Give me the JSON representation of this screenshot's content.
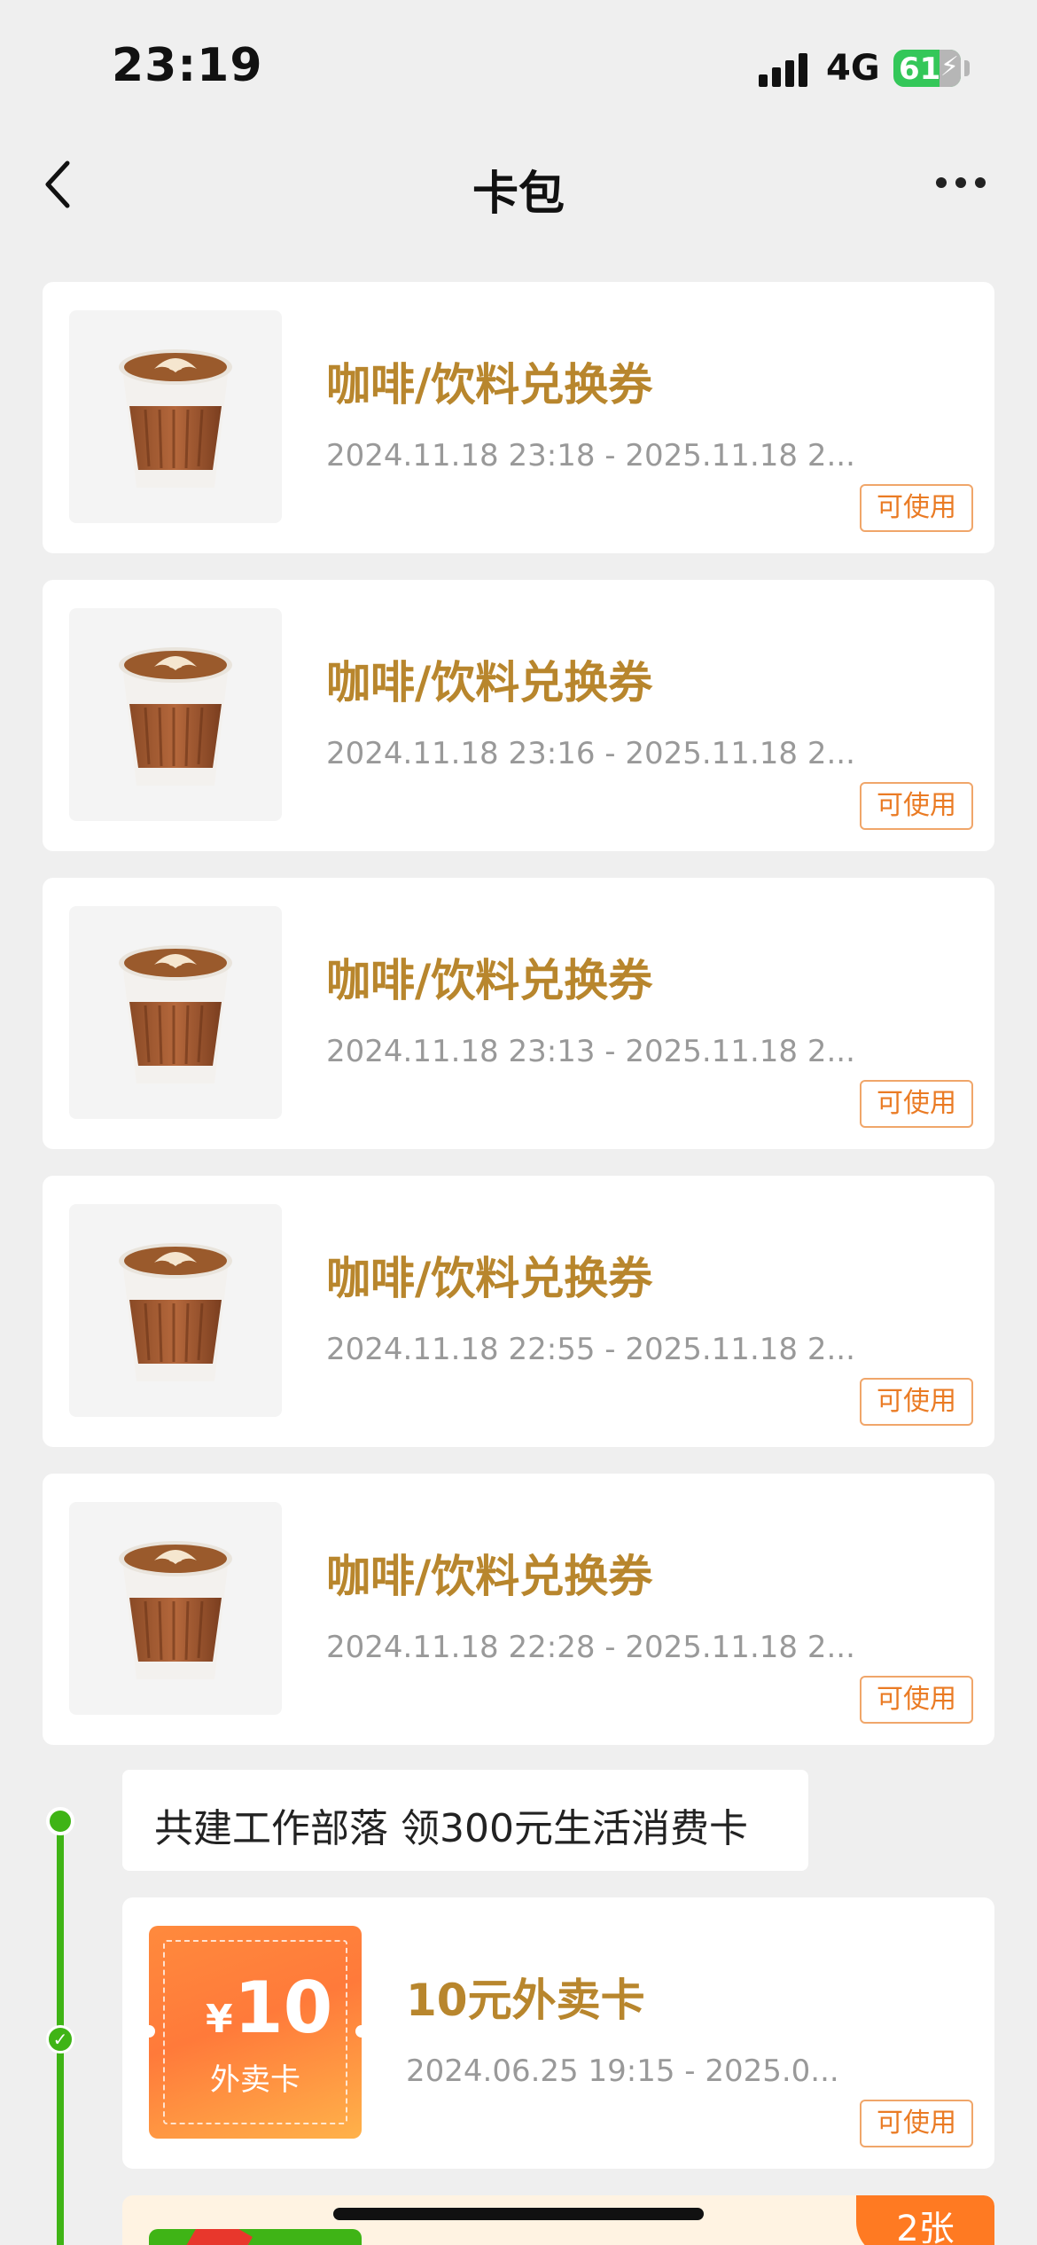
{
  "status_bar": {
    "time": "23:19",
    "network": "4G",
    "battery": "61"
  },
  "nav": {
    "title": "卡包"
  },
  "coupons": [
    {
      "title": "咖啡/饮料兑换券",
      "date": "2024.11.18 23:18 - 2025.11.18 2...",
      "status": "可使用",
      "image": "coffee-cup"
    },
    {
      "title": "咖啡/饮料兑换券",
      "date": "2024.11.18 23:16 - 2025.11.18 2...",
      "status": "可使用",
      "image": "coffee-cup"
    },
    {
      "title": "咖啡/饮料兑换券",
      "date": "2024.11.18 23:13 - 2025.11.18 2...",
      "status": "可使用",
      "image": "coffee-cup"
    },
    {
      "title": "咖啡/饮料兑换券",
      "date": "2024.11.18 22:55 - 2025.11.18 2...",
      "status": "可使用",
      "image": "coffee-cup"
    },
    {
      "title": "咖啡/饮料兑换券",
      "date": "2024.11.18 22:28 - 2025.11.18 2...",
      "status": "可使用",
      "image": "coffee-cup"
    }
  ],
  "group": {
    "header": "共建工作部落 领300元生活消费卡",
    "card": {
      "thumb_currency": "¥",
      "thumb_amount": "10",
      "thumb_label": "外卖卡",
      "title": "10元外卖卡",
      "date": "2024.06.25 19:15 - 2025.0...",
      "status": "可使用"
    },
    "next_card": {
      "badge": "2张"
    }
  },
  "colors": {
    "title_gold": "#b8862d",
    "status_orange": "#ea7b24",
    "timeline_green": "#3fb416"
  }
}
